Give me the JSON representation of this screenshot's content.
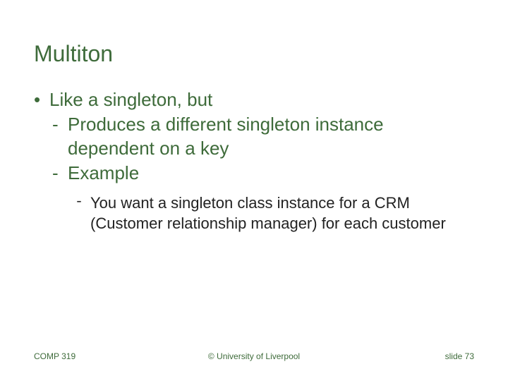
{
  "title": "Multiton",
  "bullets": {
    "lvl1": "Like a singleton, but",
    "lvl2a": "Produces a different singleton instance dependent on a key",
    "lvl2b": "Example",
    "lvl3": "You want a singleton class instance for a CRM (Customer relationship manager) for each customer"
  },
  "footer": {
    "left": "COMP 319",
    "center": "© University of Liverpool",
    "right": "slide  73"
  }
}
